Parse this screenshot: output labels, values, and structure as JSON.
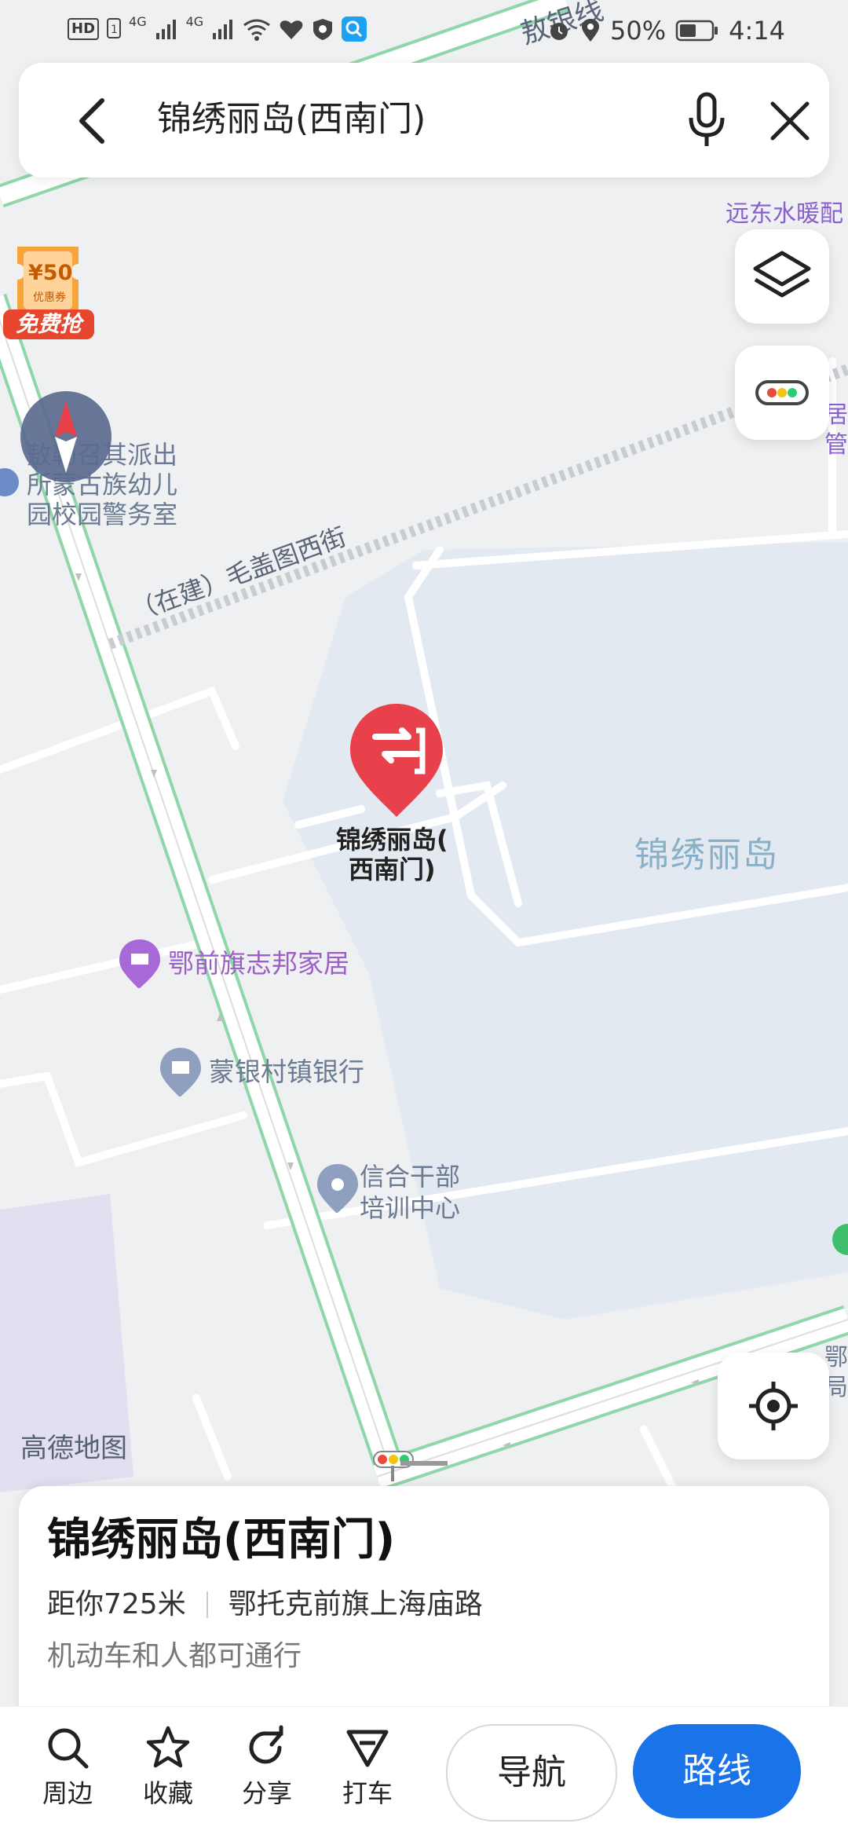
{
  "status_bar": {
    "network": "4G",
    "network2": "4G",
    "battery": "50%",
    "time": "4:14",
    "icons": [
      "hd-icon",
      "sim-icon",
      "signal-icon",
      "wifi-icon",
      "health-icon",
      "shield-icon",
      "search-app-icon",
      "alarm-icon",
      "location-icon",
      "battery-icon"
    ]
  },
  "search": {
    "query": "锦绣丽岛(西南门)",
    "back_icon": "back-arrow-icon",
    "mic_icon": "microphone-icon",
    "close_icon": "close-icon"
  },
  "coupon": {
    "amount": "¥50",
    "sub": "优惠券",
    "tag": "免费抢"
  },
  "map": {
    "road_top_label": "敖银线",
    "road_label": "（在建）毛盖图西街",
    "police_label": "敖勒召其派出\n所蒙古族幼儿\n园校园警务室",
    "area_label": "锦绣丽岛",
    "top_right_label": "远东水暖配",
    "right_edge_label1": "居\n管",
    "right_edge_label2": "鄂\n局",
    "pin_label": "锦绣丽岛(\n西南门)",
    "pois": [
      {
        "name": "鄂前旗志邦家居",
        "color": "#9b5fc6"
      },
      {
        "name": "蒙银村镇银行",
        "color": "#6b7a93"
      },
      {
        "name": "信合干部\n培训中心",
        "color": "#6b7a93"
      }
    ],
    "watermark": "高德地图",
    "pin_color": "#e8414b"
  },
  "place": {
    "title": "锦绣丽岛(西南门)",
    "distance": "距你725米",
    "address": "鄂托克前旗上海庙路",
    "note": "机动车和人都可通行"
  },
  "actions": {
    "nearby": "周边",
    "favorite": "收藏",
    "share": "分享",
    "taxi": "打车",
    "navigate": "导航",
    "route": "路线"
  },
  "colors": {
    "accent": "#1a73e8",
    "road_edge": "#8fd6a8",
    "water_area": "#e4eaf1"
  }
}
